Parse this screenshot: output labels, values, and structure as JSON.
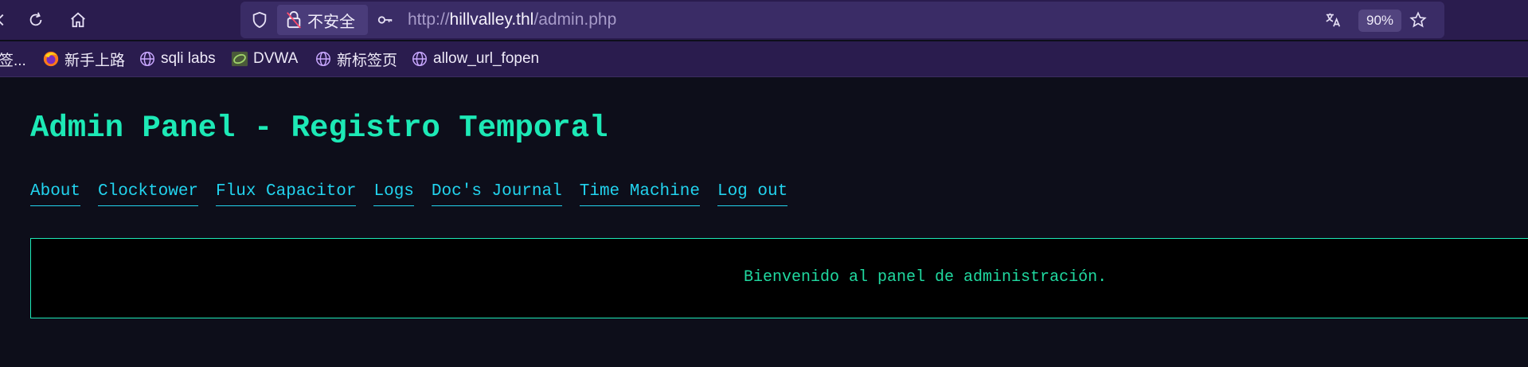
{
  "browser": {
    "security_label": "不安全",
    "url_prefix": "http://",
    "url_host": "hillvalley.thl",
    "url_path": "/admin.php",
    "zoom": "90%"
  },
  "bookmarks": [
    {
      "label": "签...",
      "icon": "bookmark-folder-icon"
    },
    {
      "label": "新手上路",
      "icon": "firefox-icon"
    },
    {
      "label": "sqli labs",
      "icon": "globe-icon"
    },
    {
      "label": "DVWA",
      "icon": "dvwa-icon"
    },
    {
      "label": "新标签页",
      "icon": "globe-icon"
    },
    {
      "label": "allow_url_fopen",
      "icon": "globe-icon"
    }
  ],
  "page": {
    "title": "Admin Panel - Registro Temporal",
    "nav": [
      {
        "label": "About"
      },
      {
        "label": "Clocktower"
      },
      {
        "label": "Flux Capacitor"
      },
      {
        "label": "Logs"
      },
      {
        "label": "Doc's Journal"
      },
      {
        "label": "Time Machine"
      },
      {
        "label": "Log out"
      }
    ],
    "welcome": "Bienvenido al panel de administración."
  },
  "colors": {
    "accent": "#1de9b6",
    "link": "#22d3ee",
    "chrome": "#2a1c4e",
    "background": "#0d0e1a"
  }
}
